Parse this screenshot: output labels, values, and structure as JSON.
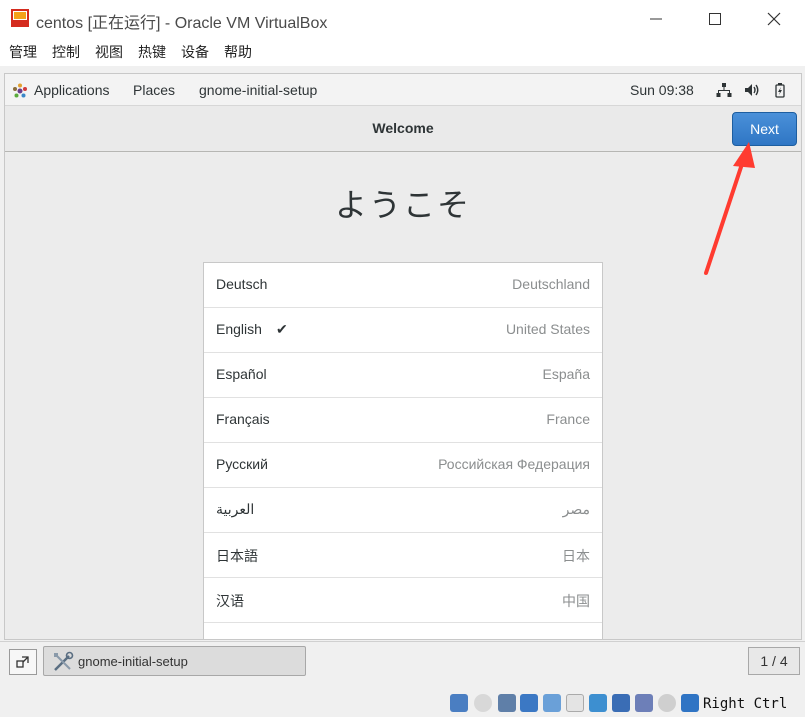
{
  "window": {
    "title": "centos [正在运行] - Oracle VM VirtualBox",
    "minimize_glyph": "—",
    "maximize_glyph": "☐",
    "close_glyph": "✕"
  },
  "host_menu": {
    "items": [
      "管理",
      "控制",
      "视图",
      "热键",
      "设备",
      "帮助"
    ]
  },
  "gnome_top_bar": {
    "applications": "Applications",
    "places": "Places",
    "app_name": "gnome-initial-setup",
    "clock": "Sun 09:38",
    "icons": [
      "network-wired-icon",
      "volume-icon",
      "battery-icon"
    ]
  },
  "setup": {
    "header_title": "Welcome",
    "next_label": "Next",
    "welcome_text": "ようこそ",
    "languages": [
      {
        "name": "Deutsch",
        "region": "Deutschland",
        "selected": false
      },
      {
        "name": "English",
        "region": "United States",
        "selected": true
      },
      {
        "name": "Español",
        "region": "España",
        "selected": false
      },
      {
        "name": "Français",
        "region": "France",
        "selected": false
      },
      {
        "name": "Русский",
        "region": "Российская Федерация",
        "selected": false
      },
      {
        "name": "العربية",
        "region": "مصر",
        "selected": false
      },
      {
        "name": "日本語",
        "region": "日本",
        "selected": false
      },
      {
        "name": "汉语",
        "region": "中国",
        "selected": false
      }
    ],
    "more_indicator": "⋮",
    "check_glyph": "✔"
  },
  "taskbar": {
    "task_label": "gnome-initial-setup",
    "workspace": "1 / 4"
  },
  "status_bar": {
    "host_key": "Right Ctrl",
    "icons": [
      "hard-disk-icon",
      "optical-drive-icon",
      "audio-icon",
      "network-icon",
      "usb-icon",
      "shared-folder-icon",
      "display-icon",
      "video-capture-icon",
      "recording-icon",
      "mouse-integration-icon",
      "keyboard-capture-icon"
    ]
  },
  "colors": {
    "next_button": "#3584e4",
    "annotation_arrow": "#ff3b30"
  }
}
